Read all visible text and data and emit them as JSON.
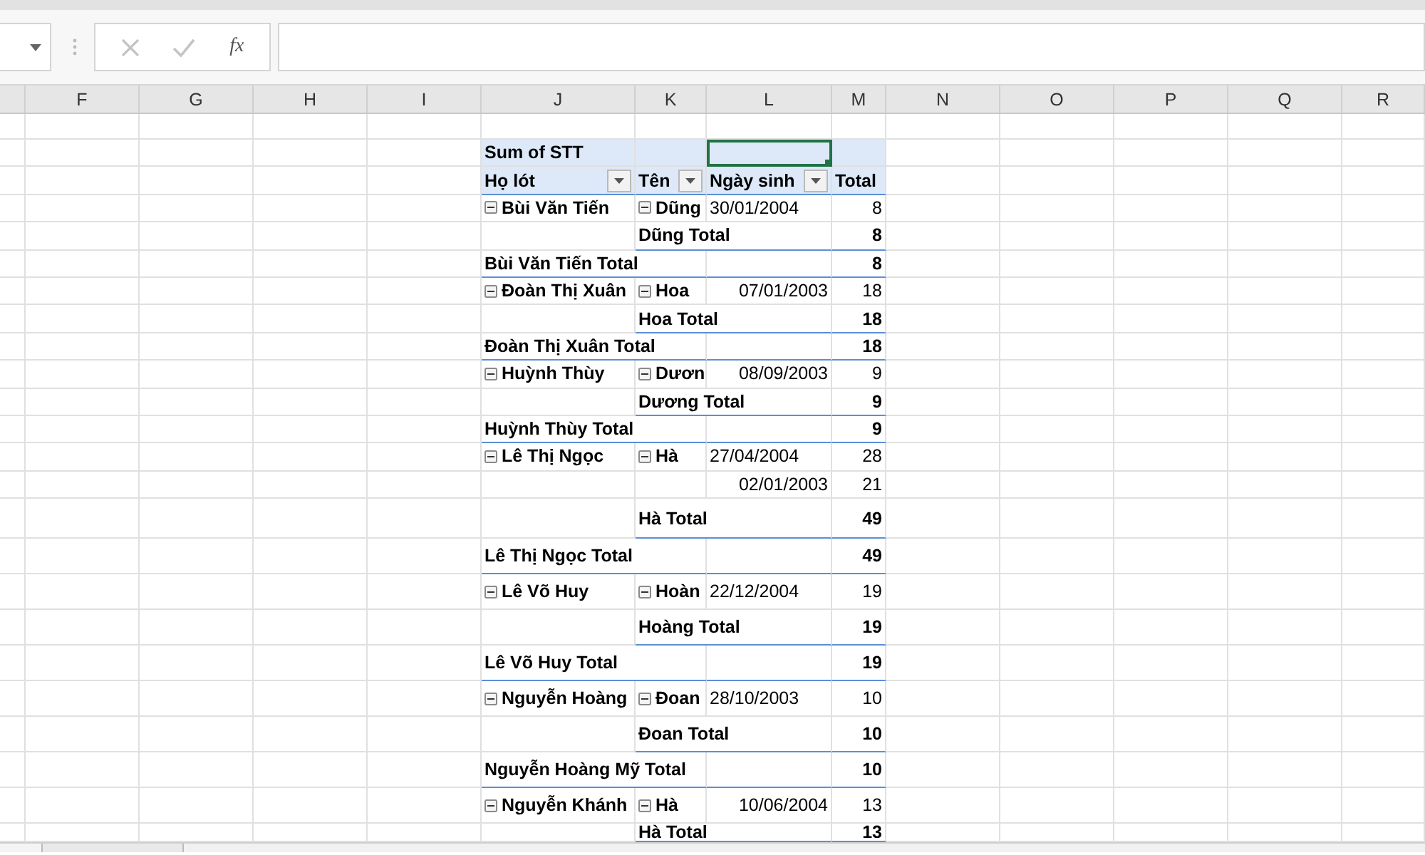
{
  "formula_bar": {
    "function_label": "fx"
  },
  "columns": [
    "F",
    "G",
    "H",
    "I",
    "J",
    "K",
    "L",
    "M",
    "N",
    "O",
    "P",
    "Q",
    "R"
  ],
  "pivot_rows": [
    {
      "kind": "title",
      "label": "Sum of STT",
      "l_selected": true
    },
    {
      "kind": "header",
      "cells": [
        {
          "label": "Họ lót",
          "filter": true
        },
        {
          "label": "Tên",
          "filter": true
        },
        {
          "label": "Ngày sinh",
          "filter": true
        },
        {
          "label": "Total",
          "filter": false
        }
      ]
    },
    {
      "kind": "detail",
      "ho_lot": {
        "text": "Bùi Văn Tiến",
        "expanded": true
      },
      "ten": {
        "text": "Dũng",
        "expanded": true
      },
      "ngay_sinh": "30/01/2004",
      "is_text": true,
      "total": "8"
    },
    {
      "kind": "subtotal",
      "label": "Dũng Total",
      "total": "8"
    },
    {
      "kind": "total",
      "label": "Bùi Văn Tiến Total",
      "total": "8"
    },
    {
      "kind": "detail",
      "ho_lot": {
        "text": "Đoàn Thị Xuân",
        "expanded": true
      },
      "ten": {
        "text": "Hoa",
        "expanded": true
      },
      "ngay_sinh": "07/01/2003",
      "is_text": false,
      "total": "18"
    },
    {
      "kind": "subtotal",
      "label": "Hoa Total",
      "total": "18"
    },
    {
      "kind": "total",
      "label": "Đoàn Thị Xuân Total",
      "total": "18"
    },
    {
      "kind": "detail",
      "ho_lot": {
        "text": "Huỳnh Thùy",
        "expanded": true
      },
      "ten": {
        "text": "Dươn",
        "expanded": true
      },
      "ngay_sinh": "08/09/2003",
      "is_text": false,
      "total": "9"
    },
    {
      "kind": "subtotal",
      "label": "Dương Total",
      "total": "9"
    },
    {
      "kind": "total",
      "label": "Huỳnh Thùy Total",
      "total": "9"
    },
    {
      "kind": "detail",
      "ho_lot": {
        "text": "Lê Thị Ngọc",
        "expanded": true
      },
      "ten": {
        "text": "Hà",
        "expanded": true
      },
      "ngay_sinh": "27/04/2004",
      "is_text": true,
      "total": "28"
    },
    {
      "kind": "detail",
      "ngay_sinh": "02/01/2003",
      "is_text": false,
      "total": "21"
    },
    {
      "kind": "subtotal",
      "label": "Hà Total",
      "total": "49"
    },
    {
      "kind": "total",
      "label": "Lê Thị Ngọc Total",
      "total": "49"
    },
    {
      "kind": "detail",
      "ho_lot": {
        "text": "Lê Võ Huy",
        "expanded": true
      },
      "ten": {
        "text": "Hoàn",
        "expanded": true
      },
      "ngay_sinh": "22/12/2004",
      "is_text": true,
      "total": "19"
    },
    {
      "kind": "subtotal",
      "label": "Hoàng Total",
      "total": "19"
    },
    {
      "kind": "total",
      "label": "Lê Võ Huy Total",
      "total": "19"
    },
    {
      "kind": "detail",
      "ho_lot": {
        "text": "Nguyễn Hoàng",
        "expanded": true
      },
      "ten": {
        "text": "Đoan",
        "expanded": true
      },
      "ngay_sinh": "28/10/2003",
      "is_text": true,
      "total": "10"
    },
    {
      "kind": "subtotal",
      "label": "Đoan Total",
      "total": "10"
    },
    {
      "kind": "total",
      "label": "Nguyễn Hoàng Mỹ Total",
      "total": "10"
    },
    {
      "kind": "detail",
      "ho_lot": {
        "text": "Nguyễn Khánh",
        "expanded": true
      },
      "ten": {
        "text": "Hà",
        "expanded": true
      },
      "ngay_sinh": "10/06/2004",
      "is_text": false,
      "total": "13"
    },
    {
      "kind": "subtotal",
      "label": "Hà Total",
      "total": "13"
    }
  ]
}
